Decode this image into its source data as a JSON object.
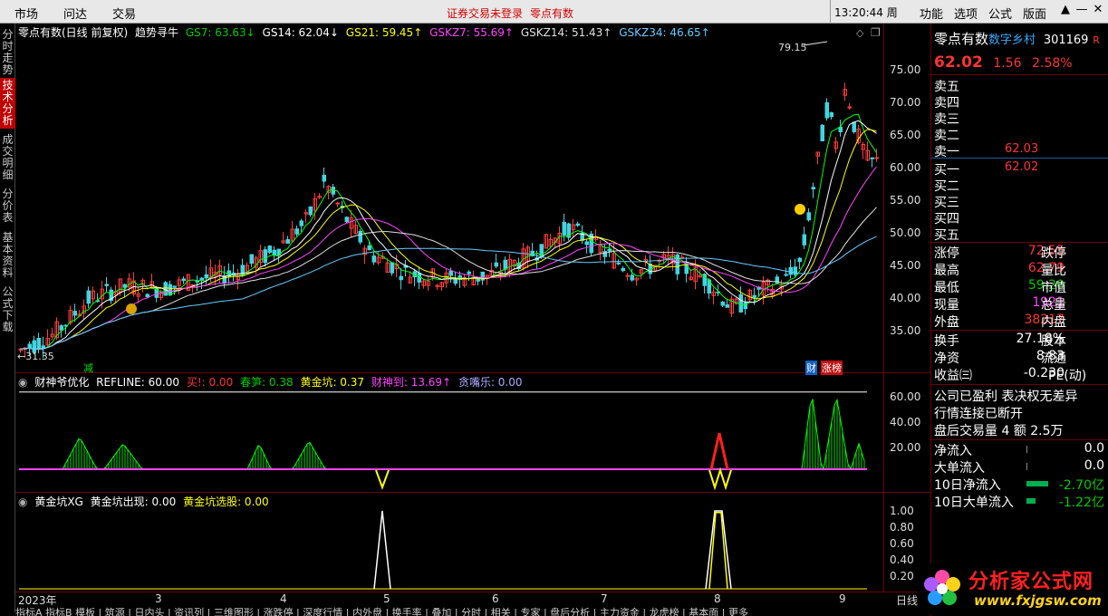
{
  "topbar": {
    "menu": [
      "市场",
      "问达",
      "交易"
    ],
    "warn1": "证券交易未登录",
    "warn2": "零点有数",
    "clock": "13:20:44 周一",
    "rmenu": [
      "功能",
      "选项",
      "公式",
      "版面"
    ],
    "controls": [
      "▲",
      "—",
      "✕"
    ]
  },
  "lefttabs": [
    "分时走势",
    "技术分析",
    "成交明细",
    "分价表",
    "基本资料",
    "公式下载"
  ],
  "main": {
    "title": "零点有数(日线 前复权)",
    "indicator": "趋势寻牛",
    "gs7": "GS7: 63.63↓",
    "gs14": "GS14: 62.04↓",
    "gs21": "GS21: 59.45↑",
    "gskz7": "GSKZ7: 55.69↑",
    "gskz14": "GSKZ14: 51.43↑",
    "gskz34": "GSKZ34: 46.65↑",
    "high_label": "79.15",
    "low_label": "←31.35",
    "ticks": [
      "75.00",
      "70.00",
      "65.00",
      "60.00",
      "55.00",
      "50.00",
      "45.00",
      "40.00",
      "35.00"
    ],
    "markers": {
      "jian": "减",
      "cai": "财",
      "zhangbang": "涨榜"
    }
  },
  "sub1": {
    "name": "财神爷优化",
    "refline": "REFLINE: 60.00",
    "buy": "买!: 0.00",
    "chunsun": "春笋: 0.38",
    "huangjinkeng": "黄金坑: 0.37",
    "caishendao": "财神到: 13.69↑",
    "tanzuile": "贪嘴乐: 0.00",
    "ticks": [
      "60.00",
      "40.00",
      "20.00"
    ]
  },
  "sub2": {
    "name": "黄金坑XG",
    "appear": "黄金坑出现: 0.00",
    "pick": "黄金坑选股: 0.00",
    "ticks": [
      "1.00",
      "0.80",
      "0.60",
      "0.40",
      "0.20"
    ]
  },
  "xaxis": {
    "labels": [
      "2023年",
      "3",
      "4",
      "5",
      "6",
      "7",
      "8",
      "9"
    ],
    "period": "日线"
  },
  "statusbar": "指标A 指标B 模板 | 筑源 | 日内头 | 资讯列 | 三维图形 | 涨跌停 | 深度行情 | 内外盘 | 换手率 | 叠加 | 分时 | 相关 | 专家 | 盘后分析 | 主力资金 | 龙虎榜 | 基本面 | 更多",
  "quote": {
    "name": "零点有数",
    "tag": "数字乡村",
    "code": "301169",
    "flag": "R",
    "price": "62.02",
    "change": "1.56",
    "pct": "2.58%",
    "ask": [
      {
        "label": "卖五",
        "price": ""
      },
      {
        "label": "卖四",
        "price": ""
      },
      {
        "label": "卖三",
        "price": ""
      },
      {
        "label": "卖二",
        "price": ""
      },
      {
        "label": "卖一",
        "price": "62.03"
      }
    ],
    "bid": [
      {
        "label": "买一",
        "price": "62.02"
      },
      {
        "label": "买二",
        "price": ""
      },
      {
        "label": "买三",
        "price": ""
      },
      {
        "label": "买四",
        "price": ""
      },
      {
        "label": "买五",
        "price": ""
      }
    ],
    "stats": [
      {
        "l": "涨停",
        "v": "72.55",
        "l2": "跌停",
        "c": "red"
      },
      {
        "l": "最高",
        "v": "62.79",
        "l2": "量比",
        "c": "red"
      },
      {
        "l": "最低",
        "v": "59.20",
        "l2": "市值",
        "c": "green"
      },
      {
        "l": "现量",
        "v": "1921",
        "l2": "总量",
        "c": "magenta"
      },
      {
        "l": "外盘",
        "v": "38217",
        "l2": "内盘",
        "c": "red"
      }
    ],
    "stats2": [
      {
        "l": "换手",
        "v": "27.18%",
        "l2": "股本"
      },
      {
        "l": "净资",
        "v": "8.83",
        "l2": "流通"
      },
      {
        "l": "收益㈢",
        "v": "-0.230",
        "l2": "PE(动)"
      }
    ],
    "notes": [
      "公司已盈利 表决权无差异",
      "行情连接已断开",
      "盘后交易量 4 额 2.5万"
    ],
    "flows": [
      {
        "l": "净流入",
        "v": "0.0"
      },
      {
        "l": "大单流入",
        "v": "0.0"
      },
      {
        "l": "10日净流入",
        "v": "-2.70亿"
      },
      {
        "l": "10日大单流入",
        "v": "-1.22亿"
      }
    ]
  },
  "logo": {
    "cn": "分析家公式网",
    "url": "www.fxjgsw.com"
  }
}
